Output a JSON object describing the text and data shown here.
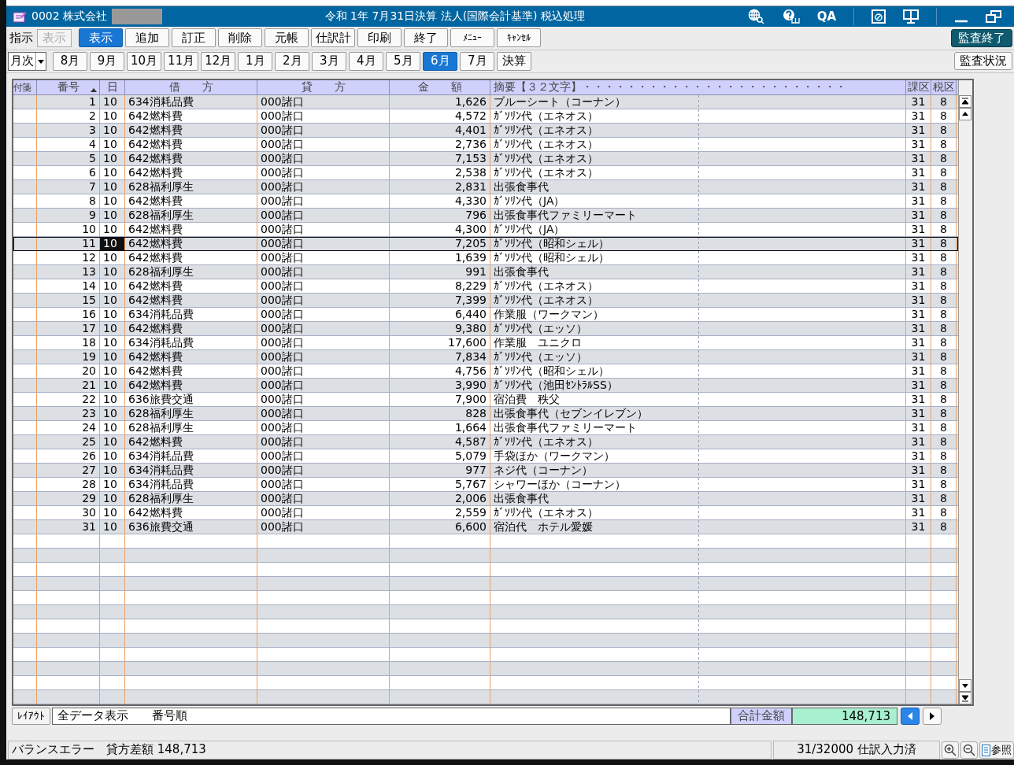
{
  "window": {
    "company": "0002 株式会社",
    "title": "令和 1年 7月31日決算 法人(国際会計基準) 税込処理",
    "qa_label": "QA"
  },
  "toolbar": {
    "label": "指示",
    "mode_field": {
      "value": "表示",
      "disabled": true
    },
    "buttons": [
      {
        "label": "表示",
        "selected": true
      },
      {
        "label": "追加",
        "selected": false
      },
      {
        "label": "訂正",
        "selected": false
      },
      {
        "label": "削除",
        "selected": false
      },
      {
        "label": "元帳",
        "selected": false
      },
      {
        "label": "仕訳計",
        "selected": false
      },
      {
        "label": "印刷",
        "selected": false
      },
      {
        "label": "終了",
        "selected": false
      },
      {
        "label": "ﾒﾆｭｰ",
        "selected": false
      },
      {
        "label": "ｷｬﾝｾﾙ",
        "selected": false
      }
    ],
    "audit_end_button": "監査終了"
  },
  "period_bar": {
    "dropdown": "月次",
    "months": [
      {
        "label": "8月",
        "selected": false
      },
      {
        "label": "9月",
        "selected": false
      },
      {
        "label": "10月",
        "selected": false
      },
      {
        "label": "11月",
        "selected": false
      },
      {
        "label": "12月",
        "selected": false
      },
      {
        "label": "1月",
        "selected": false
      },
      {
        "label": "2月",
        "selected": false
      },
      {
        "label": "3月",
        "selected": false
      },
      {
        "label": "4月",
        "selected": false
      },
      {
        "label": "5月",
        "selected": false
      },
      {
        "label": "6月",
        "selected": true
      },
      {
        "label": "7月",
        "selected": false
      },
      {
        "label": "決算",
        "selected": false
      }
    ],
    "audit_status_button": "監査状況"
  },
  "table": {
    "columns": [
      "付箋",
      "番号",
      "日",
      "借　　方",
      "貸　　方",
      "金　　額",
      "摘要【３２文字】・・・・・・・・・・・・・・・・・・・・・・・・",
      "課区",
      "税区"
    ],
    "rows": [
      {
        "no": "1",
        "day": "10",
        "debit": "634消耗品費",
        "credit": "000諸口",
        "amount": "1,626",
        "memo": "ブルーシート（コーナン）",
        "tax_class": "31",
        "tax_rate": "8",
        "selected": false
      },
      {
        "no": "2",
        "day": "10",
        "debit": "642燃料費",
        "credit": "000諸口",
        "amount": "4,572",
        "memo": "ｶﾞｿﾘﾝ代（エネオス）",
        "tax_class": "31",
        "tax_rate": "8",
        "selected": false
      },
      {
        "no": "3",
        "day": "10",
        "debit": "642燃料費",
        "credit": "000諸口",
        "amount": "4,401",
        "memo": "ｶﾞｿﾘﾝ代（エネオス）",
        "tax_class": "31",
        "tax_rate": "8",
        "selected": false
      },
      {
        "no": "4",
        "day": "10",
        "debit": "642燃料費",
        "credit": "000諸口",
        "amount": "2,736",
        "memo": "ｶﾞｿﾘﾝ代（エネオス）",
        "tax_class": "31",
        "tax_rate": "8",
        "selected": false
      },
      {
        "no": "5",
        "day": "10",
        "debit": "642燃料費",
        "credit": "000諸口",
        "amount": "7,153",
        "memo": "ｶﾞｿﾘﾝ代（エネオス）",
        "tax_class": "31",
        "tax_rate": "8",
        "selected": false
      },
      {
        "no": "6",
        "day": "10",
        "debit": "642燃料費",
        "credit": "000諸口",
        "amount": "2,538",
        "memo": "ｶﾞｿﾘﾝ代（エネオス）",
        "tax_class": "31",
        "tax_rate": "8",
        "selected": false
      },
      {
        "no": "7",
        "day": "10",
        "debit": "628福利厚生",
        "credit": "000諸口",
        "amount": "2,831",
        "memo": "出張食事代",
        "tax_class": "31",
        "tax_rate": "8",
        "selected": false
      },
      {
        "no": "8",
        "day": "10",
        "debit": "642燃料費",
        "credit": "000諸口",
        "amount": "4,330",
        "memo": "ｶﾞｿﾘﾝ代（JA）",
        "tax_class": "31",
        "tax_rate": "8",
        "selected": false
      },
      {
        "no": "9",
        "day": "10",
        "debit": "628福利厚生",
        "credit": "000諸口",
        "amount": "796",
        "memo": "出張食事代ファミリーマート",
        "tax_class": "31",
        "tax_rate": "8",
        "selected": false
      },
      {
        "no": "10",
        "day": "10",
        "debit": "642燃料費",
        "credit": "000諸口",
        "amount": "4,300",
        "memo": "ｶﾞｿﾘﾝ代（JA）",
        "tax_class": "31",
        "tax_rate": "8",
        "selected": false
      },
      {
        "no": "11",
        "day": "10",
        "debit": "642燃料費",
        "credit": "000諸口",
        "amount": "7,205",
        "memo": "ｶﾞｿﾘﾝ代（昭和シェル）",
        "tax_class": "31",
        "tax_rate": "8",
        "selected": true
      },
      {
        "no": "12",
        "day": "10",
        "debit": "642燃料費",
        "credit": "000諸口",
        "amount": "1,639",
        "memo": "ｶﾞｿﾘﾝ代（昭和シェル）",
        "tax_class": "31",
        "tax_rate": "8",
        "selected": false
      },
      {
        "no": "13",
        "day": "10",
        "debit": "628福利厚生",
        "credit": "000諸口",
        "amount": "991",
        "memo": "出張食事代",
        "tax_class": "31",
        "tax_rate": "8",
        "selected": false
      },
      {
        "no": "14",
        "day": "10",
        "debit": "642燃料費",
        "credit": "000諸口",
        "amount": "8,229",
        "memo": "ｶﾞｿﾘﾝ代（エネオス）",
        "tax_class": "31",
        "tax_rate": "8",
        "selected": false
      },
      {
        "no": "15",
        "day": "10",
        "debit": "642燃料費",
        "credit": "000諸口",
        "amount": "7,399",
        "memo": "ｶﾞｿﾘﾝ代（エネオス）",
        "tax_class": "31",
        "tax_rate": "8",
        "selected": false
      },
      {
        "no": "16",
        "day": "10",
        "debit": "634消耗品費",
        "credit": "000諸口",
        "amount": "6,440",
        "memo": "作業服（ワークマン）",
        "tax_class": "31",
        "tax_rate": "8",
        "selected": false
      },
      {
        "no": "17",
        "day": "10",
        "debit": "642燃料費",
        "credit": "000諸口",
        "amount": "9,380",
        "memo": "ｶﾞｿﾘﾝ代（エッソ）",
        "tax_class": "31",
        "tax_rate": "8",
        "selected": false
      },
      {
        "no": "18",
        "day": "10",
        "debit": "634消耗品費",
        "credit": "000諸口",
        "amount": "17,600",
        "memo": "作業服　ユニクロ",
        "tax_class": "31",
        "tax_rate": "8",
        "selected": false
      },
      {
        "no": "19",
        "day": "10",
        "debit": "642燃料費",
        "credit": "000諸口",
        "amount": "7,834",
        "memo": "ｶﾞｿﾘﾝ代（エッソ）",
        "tax_class": "31",
        "tax_rate": "8",
        "selected": false
      },
      {
        "no": "20",
        "day": "10",
        "debit": "642燃料費",
        "credit": "000諸口",
        "amount": "4,756",
        "memo": "ｶﾞｿﾘﾝ代（昭和シェル）",
        "tax_class": "31",
        "tax_rate": "8",
        "selected": false
      },
      {
        "no": "21",
        "day": "10",
        "debit": "642燃料費",
        "credit": "000諸口",
        "amount": "3,990",
        "memo": "ｶﾞｿﾘﾝ代（池田ｾﾝﾄﾗﾙSS）",
        "tax_class": "31",
        "tax_rate": "8",
        "selected": false
      },
      {
        "no": "22",
        "day": "10",
        "debit": "636旅費交通",
        "credit": "000諸口",
        "amount": "7,900",
        "memo": "宿泊費　秩父",
        "tax_class": "31",
        "tax_rate": "8",
        "selected": false
      },
      {
        "no": "23",
        "day": "10",
        "debit": "628福利厚生",
        "credit": "000諸口",
        "amount": "828",
        "memo": "出張食事代（セブンイレブン）",
        "tax_class": "31",
        "tax_rate": "8",
        "selected": false
      },
      {
        "no": "24",
        "day": "10",
        "debit": "628福利厚生",
        "credit": "000諸口",
        "amount": "1,664",
        "memo": "出張食事代ファミリーマート",
        "tax_class": "31",
        "tax_rate": "8",
        "selected": false
      },
      {
        "no": "25",
        "day": "10",
        "debit": "642燃料費",
        "credit": "000諸口",
        "amount": "4,587",
        "memo": "ｶﾞｿﾘﾝ代（エネオス）",
        "tax_class": "31",
        "tax_rate": "8",
        "selected": false
      },
      {
        "no": "26",
        "day": "10",
        "debit": "634消耗品費",
        "credit": "000諸口",
        "amount": "5,079",
        "memo": "手袋ほか（ワークマン）",
        "tax_class": "31",
        "tax_rate": "8",
        "selected": false
      },
      {
        "no": "27",
        "day": "10",
        "debit": "634消耗品費",
        "credit": "000諸口",
        "amount": "977",
        "memo": "ネジ代（コーナン）",
        "tax_class": "31",
        "tax_rate": "8",
        "selected": false
      },
      {
        "no": "28",
        "day": "10",
        "debit": "634消耗品費",
        "credit": "000諸口",
        "amount": "5,767",
        "memo": "シャワーほか（コーナン）",
        "tax_class": "31",
        "tax_rate": "8",
        "selected": false
      },
      {
        "no": "29",
        "day": "10",
        "debit": "628福利厚生",
        "credit": "000諸口",
        "amount": "2,006",
        "memo": "出張食事代",
        "tax_class": "31",
        "tax_rate": "8",
        "selected": false
      },
      {
        "no": "30",
        "day": "10",
        "debit": "642燃料費",
        "credit": "000諸口",
        "amount": "2,559",
        "memo": "ｶﾞｿﾘﾝ代（エネオス）",
        "tax_class": "31",
        "tax_rate": "8",
        "selected": false
      },
      {
        "no": "31",
        "day": "10",
        "debit": "636旅費交通",
        "credit": "000諸口",
        "amount": "6,600",
        "memo": "宿泊代　ホテル愛媛",
        "tax_class": "31",
        "tax_rate": "8",
        "selected": false
      }
    ]
  },
  "footer": {
    "layout_button": "ﾚｲｱｳﾄ",
    "filter": "全データ表示",
    "sort": "番号順",
    "total_label": "合計金額",
    "total": "148,713",
    "nav_buttons": [
      {
        "kind": "prev",
        "selected": true
      },
      {
        "kind": "next",
        "selected": false
      }
    ]
  },
  "status_bar": {
    "message": "バランスエラー　貸方差額 148,713",
    "count": "31/32000 仕訳入力済",
    "reference_button": "参照"
  }
}
